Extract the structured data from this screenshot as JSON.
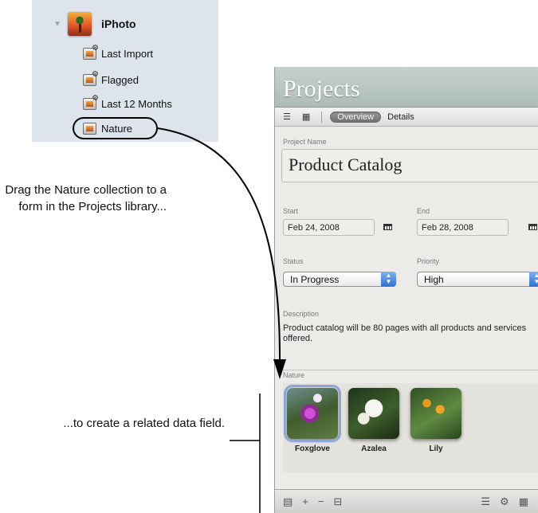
{
  "sidebar": {
    "app_label": "iPhoto",
    "albums": [
      "Last Import",
      "Flagged",
      "Last 12 Months",
      "Nature"
    ]
  },
  "callouts": {
    "drag_text": "Drag the Nature collection to a form in the Projects library...",
    "create_text": "...to create a related data field."
  },
  "window": {
    "title": "Projects",
    "tabs": {
      "overview": "Overview",
      "details": "Details"
    },
    "form": {
      "project_name_label": "Project Name",
      "project_name": "Product Catalog",
      "start_label": "Start",
      "start": "Feb 24, 2008",
      "end_label": "End",
      "end": "Feb 28, 2008",
      "status_label": "Status",
      "status": "In Progress",
      "priority_label": "Priority",
      "priority": "High",
      "description_label": "Description",
      "description": "Product catalog will be 80 pages with all products and services offered.",
      "nature_label": "Nature",
      "photos": [
        "Foxglove",
        "Azalea",
        "Lily"
      ]
    },
    "bottom_bar": {
      "left_icons": [
        "add-record-icon",
        "plus-icon",
        "minus-icon",
        "field-icon"
      ],
      "right_icons": [
        "list-icon",
        "gear-icon",
        "grid-icon"
      ]
    }
  },
  "colors": {
    "sidebar_bg": "#dde4ec",
    "header_bg": "#aebcb7",
    "selection_outline": "#8aa7d6"
  }
}
